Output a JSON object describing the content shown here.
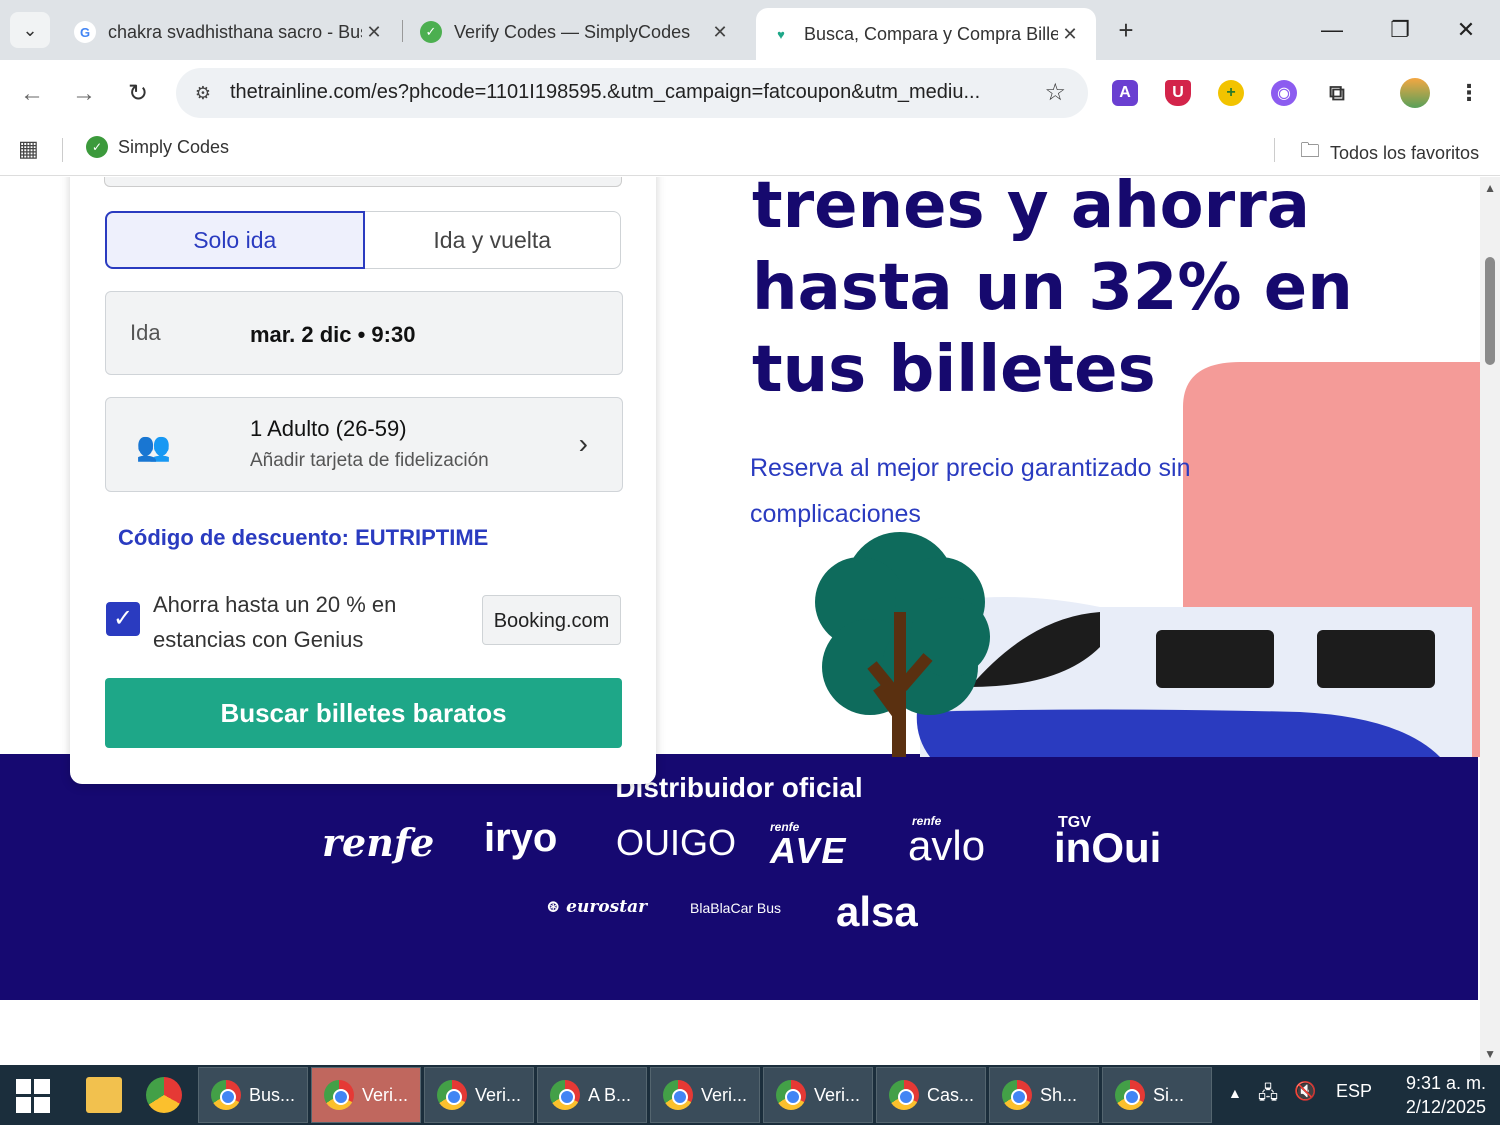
{
  "browser": {
    "tabs": [
      {
        "title": "chakra svadhisthana sacro - Bus",
        "favicon": "google-icon",
        "active": false
      },
      {
        "title": "Verify Codes — SimplyCodes",
        "favicon": "simplycodes-icon",
        "active": false
      },
      {
        "title": "Busca, Compara y Compra Bille",
        "favicon": "trainline-icon",
        "active": true
      }
    ],
    "url": "thetrainline.com/es?phcode=1101I198595.&utm_campaign=fatcoupon&utm_mediu...",
    "bookmarks": [
      {
        "label": "Simply Codes"
      }
    ],
    "all_bookmarks_label": "Todos los favoritos"
  },
  "search_card": {
    "trip_one_way": "Solo ida",
    "trip_return": "Ida y vuelta",
    "date_label": "Ida",
    "date_value": "mar. 2 dic • 9:30",
    "passenger_main": "1 Adulto (26-59)",
    "passenger_sub": "Añadir tarjeta de fidelización",
    "discount_code": "Código de descuento: EUTRIPTIME",
    "genius_text": "Ahorra hasta un 20 % en estancias con Genius",
    "genius_checked": true,
    "booking_label": "Booking.com",
    "search_button": "Buscar billetes baratos"
  },
  "hero": {
    "headline": "trenes y ahorra hasta un 32% en tus billetes",
    "subline": "Reserva al mejor precio garantizado sin complicaciones"
  },
  "distributor": {
    "title": "Distribuidor oficial",
    "logos": [
      "renfe",
      "iryo",
      "OUIGO",
      "AVE",
      "avlo",
      "inOui",
      "eurostar",
      "BlaBlaCar Bus",
      "alsa"
    ],
    "ave_small": "renfe",
    "avlo_small": "renfe",
    "inoui_small": "TGV"
  },
  "taskbar": {
    "items": [
      {
        "label": "Bus...",
        "active": false
      },
      {
        "label": "Veri...",
        "active": true
      },
      {
        "label": "Veri...",
        "active": false
      },
      {
        "label": "A B...",
        "active": false
      },
      {
        "label": "Veri...",
        "active": false
      },
      {
        "label": "Veri...",
        "active": false
      },
      {
        "label": "Cas...",
        "active": false
      },
      {
        "label": "Sh...",
        "active": false
      },
      {
        "label": "Si...",
        "active": false
      }
    ],
    "language": "ESP",
    "time": "9:31 a. m.",
    "date": "2/12/2025"
  },
  "colors": {
    "brand_navy": "#16096e",
    "brand_blue": "#2a3bc0",
    "cta_green": "#1ea788",
    "salmon": "#f49b98"
  }
}
